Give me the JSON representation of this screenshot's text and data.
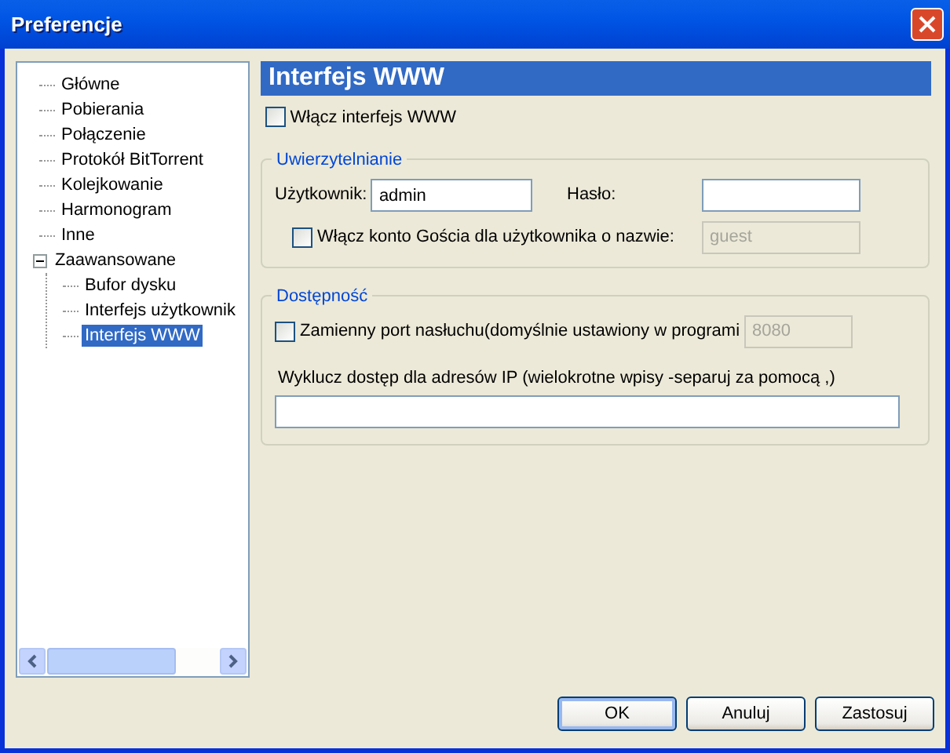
{
  "window": {
    "title": "Preferencje"
  },
  "tree": [
    {
      "label": "Główne",
      "selected": false
    },
    {
      "label": "Pobierania",
      "selected": false
    },
    {
      "label": "Połączenie",
      "selected": false
    },
    {
      "label": "Protokół BitTorrent",
      "selected": false
    },
    {
      "label": "Kolejkowanie",
      "selected": false
    },
    {
      "label": "Harmonogram",
      "selected": false
    },
    {
      "label": "Inne",
      "selected": false
    },
    {
      "label": "Zaawansowane",
      "selected": false,
      "expanded": true,
      "children": [
        {
          "label": "Bufor dysku",
          "selected": false
        },
        {
          "label": "Interfejs użytkownik",
          "selected": false
        },
        {
          "label": "Interfejs WWW",
          "selected": true
        }
      ]
    }
  ],
  "page": {
    "heading": "Interfejs WWW",
    "enable": {
      "label": "Włącz interfejs WWW",
      "checked": false
    }
  },
  "auth": {
    "title": "Uwierzytelnianie",
    "user_label": "Użytkownik:",
    "user_value": "admin",
    "password_label": "Hasło:",
    "guest": {
      "label": "Włącz konto Gościa dla użytkownika o nazwie:",
      "checked": false
    },
    "guest_value": "guest"
  },
  "access": {
    "title": "Dostępność",
    "port": {
      "label": "Zamienny port nasłuchu(domyślnie ustawiony w programi",
      "checked": false
    },
    "port_value": "8080",
    "exclude_label": "Wyklucz dostęp dla adresów IP (wielokrotne wpisy -separuj za pomocą ,)"
  },
  "buttons": [
    {
      "label": "OK",
      "default": true
    },
    {
      "label": "Anuluj",
      "default": false
    },
    {
      "label": "Zastosuj",
      "default": false
    }
  ]
}
